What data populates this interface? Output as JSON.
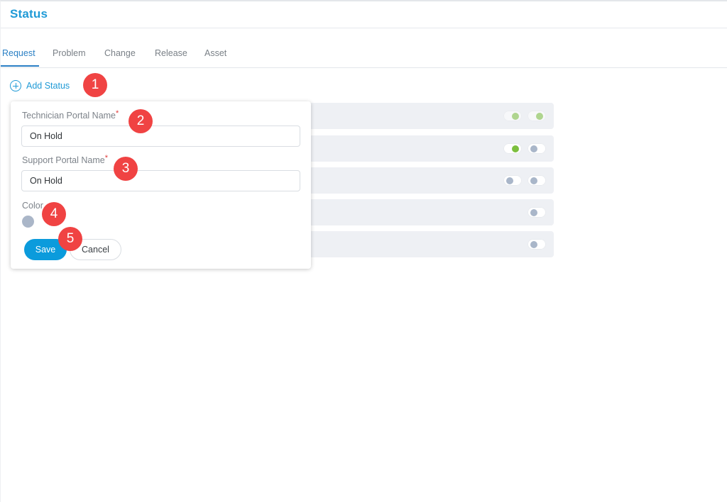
{
  "page": {
    "title": "Status"
  },
  "tabs": [
    {
      "label": "Request",
      "active": true
    },
    {
      "label": "Problem",
      "active": false
    },
    {
      "label": "Change",
      "active": false
    },
    {
      "label": "Release",
      "active": false
    },
    {
      "label": "Asset",
      "active": false
    }
  ],
  "add_status": {
    "label": "Add Status",
    "icon": "plus-circle-icon"
  },
  "form": {
    "technician_label": "Technician Portal Name",
    "technician_value": "On Hold",
    "support_label": "Support Portal Name",
    "support_value": "On Hold",
    "required_mark": "*",
    "color_label": "Color",
    "save_label": "Save",
    "cancel_label": "Cancel"
  },
  "status_rows": [
    {
      "toggles": [
        "on",
        "on"
      ],
      "faded": true
    },
    {
      "toggles": [
        "on",
        "off"
      ],
      "faded": false
    },
    {
      "toggles": [
        "off",
        "off"
      ],
      "faded": false
    },
    {
      "toggles": [
        "off"
      ],
      "faded": false
    },
    {
      "toggles": [
        "off"
      ],
      "faded": false
    }
  ],
  "callouts": [
    "1",
    "2",
    "3",
    "4",
    "5"
  ],
  "colors": {
    "accent": "#1f9ad6",
    "tab_active": "#2a7fc4",
    "save_button": "#0b9bdc",
    "callout": "#f04343",
    "row_background": "#eef0f4",
    "toggle_on_knob": "#7cbf3e",
    "toggle_off_knob": "#a9b6c9",
    "status_color": "#aab6c8"
  }
}
